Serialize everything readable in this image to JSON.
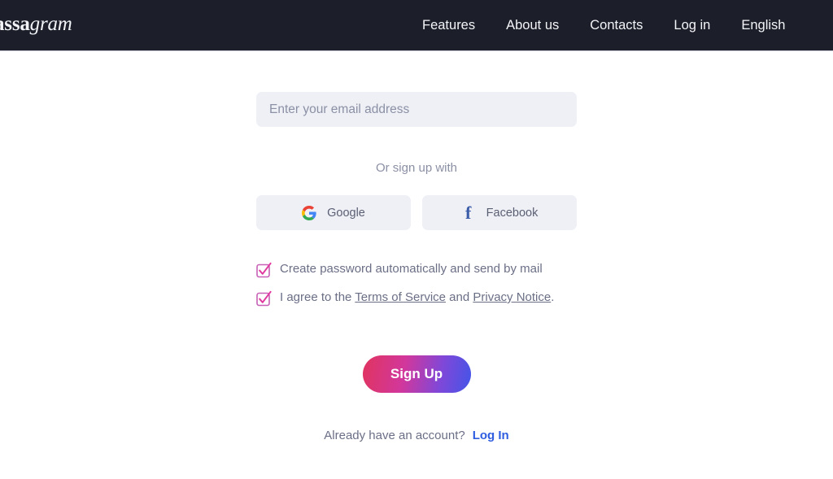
{
  "header": {
    "brand": {
      "bold_part": "assa",
      "italic_part": "gram"
    },
    "nav": [
      {
        "label": "Features",
        "name": "nav-link-features"
      },
      {
        "label": "About us",
        "name": "nav-link-about-us"
      },
      {
        "label": "Contacts",
        "name": "nav-link-contacts"
      },
      {
        "label": "Log in",
        "name": "nav-link-log-in"
      },
      {
        "label": "English",
        "name": "nav-link-english"
      }
    ],
    "background_color": "#1c1f2a"
  },
  "signup_form": {
    "email": {
      "value": "",
      "placeholder": "Enter your email address"
    },
    "divider_text": "Or sign up with",
    "social_buttons": [
      {
        "label": "Google",
        "icon": "google-g-icon"
      },
      {
        "label": "Facebook",
        "icon": "facebook-f-icon"
      }
    ],
    "checkboxes": [
      {
        "checked": true,
        "text": "Create password automatically and send by mail"
      },
      {
        "checked": true,
        "text_before": "I agree to the ",
        "link1": "Terms of Service",
        "text_middle": " and ",
        "link2": "Privacy Notice",
        "text_after": "."
      }
    ],
    "submit_label": "Sign Up",
    "footer": {
      "prompt": "Already have an account?",
      "link_label": "Log In"
    }
  },
  "colors": {
    "accent_pink": "#e0345f",
    "accent_blue": "#4355e8",
    "checkbox_pink": "#d946a6",
    "link_blue": "#2f5de0",
    "field_bg": "#eef0f5",
    "muted_text": "#6b6f86"
  }
}
